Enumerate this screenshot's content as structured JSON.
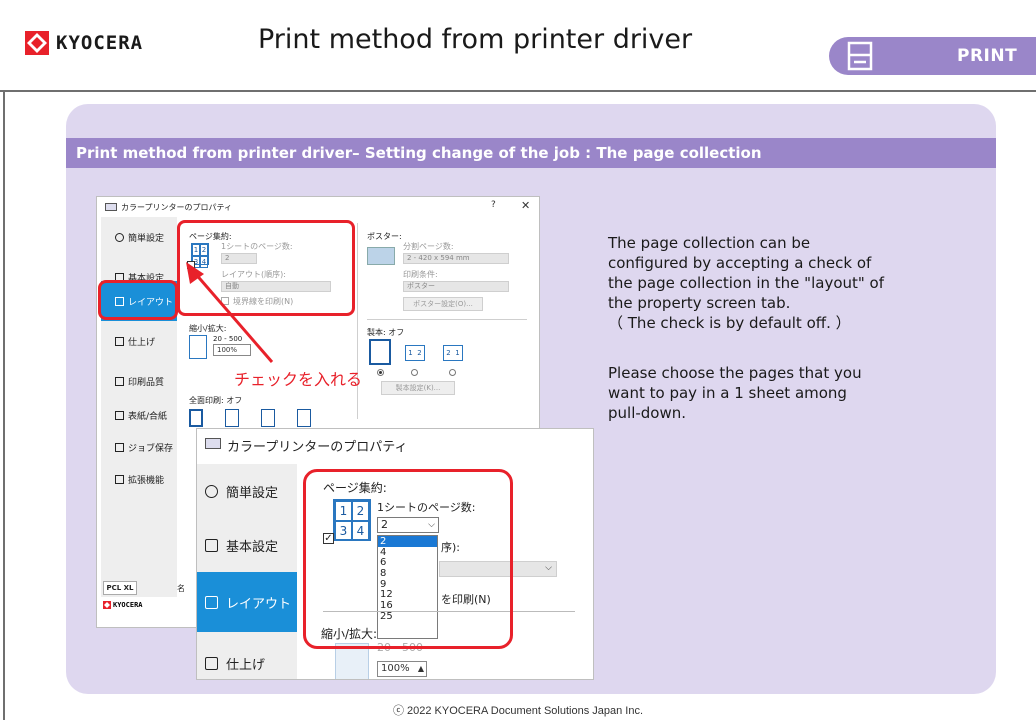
{
  "header": {
    "brand": "KYOCERA",
    "title": "Print method from printer driver",
    "badge": "PRINT"
  },
  "section_title": "Print method from printer driver– Setting change of the job : The page collection",
  "description": {
    "p1_lines": [
      "The page collection can be",
      "configured by accepting a check of",
      "the page collection in the \"layout\" of",
      "the property screen tab.",
      "（ The check is by default off. ）"
    ],
    "p2_lines": [
      "Please choose the pages that you",
      "want to pay in a 1 sheet among",
      "pull-down."
    ]
  },
  "callout": "チェックを入れる",
  "copyright": "ⓒ 2022 KYOCERA Document Solutions Japan Inc.",
  "dialog_small": {
    "title": "カラープリンターのプロパティ",
    "help": "?",
    "close": "✕",
    "sidebar": [
      "簡単設定",
      "基本設定",
      "レイアウト",
      "仕上げ",
      "印刷品質",
      "表紙/合紙",
      "ジョブ保存",
      "拡張機能"
    ],
    "page_collect_label": "ページ集約:",
    "pages_per_sheet_label": "1シートのページ数:",
    "pages_per_sheet_value": "2",
    "layout_order_label": "レイアウト(順序):",
    "layout_order_value": "自動",
    "border_label": "境界線を印刷(N)",
    "poster_label": "ポスター:",
    "split_pages_label": "分割ページ数:",
    "split_pages_value": "2 - 420 x 594 mm",
    "print_cond_label": "印刷条件:",
    "print_cond_value": "ポスター",
    "poster_settings_btn": "ポスター設定(O)...",
    "scale_label": "縮小/拡大:",
    "scale_range": "20 - 500",
    "scale_value": "100%",
    "booklet_label": "製本: オフ",
    "booklet_settings_btn": "製本設定(K)...",
    "fullpage_label": "全面印刷: オフ",
    "pcl_label": "PCL XL",
    "name_label": "名",
    "footer_logo": "KYOCERA"
  },
  "dialog_large": {
    "title": "カラープリンターのプロパティ",
    "sidebar": [
      "簡単設定",
      "基本設定",
      "レイアウト",
      "仕上げ"
    ],
    "page_collect_label": "ページ集約:",
    "pages_per_sheet_label": "1シートのページ数:",
    "dropdown_value": "2",
    "dropdown_options": [
      "2",
      "4",
      "6",
      "8",
      "9",
      "12",
      "16",
      "25"
    ],
    "order_partial": "序):",
    "print_partial": "を印刷(N)",
    "scale_label": "縮小/拡大:",
    "scale_range": "20 - 500",
    "scale_value": "100%"
  },
  "colors": {
    "accent_purple": "#9a86c9",
    "panel_bg": "#ded7ef",
    "highlight_red": "#e8212a",
    "selected_blue": "#1a8fd8"
  }
}
